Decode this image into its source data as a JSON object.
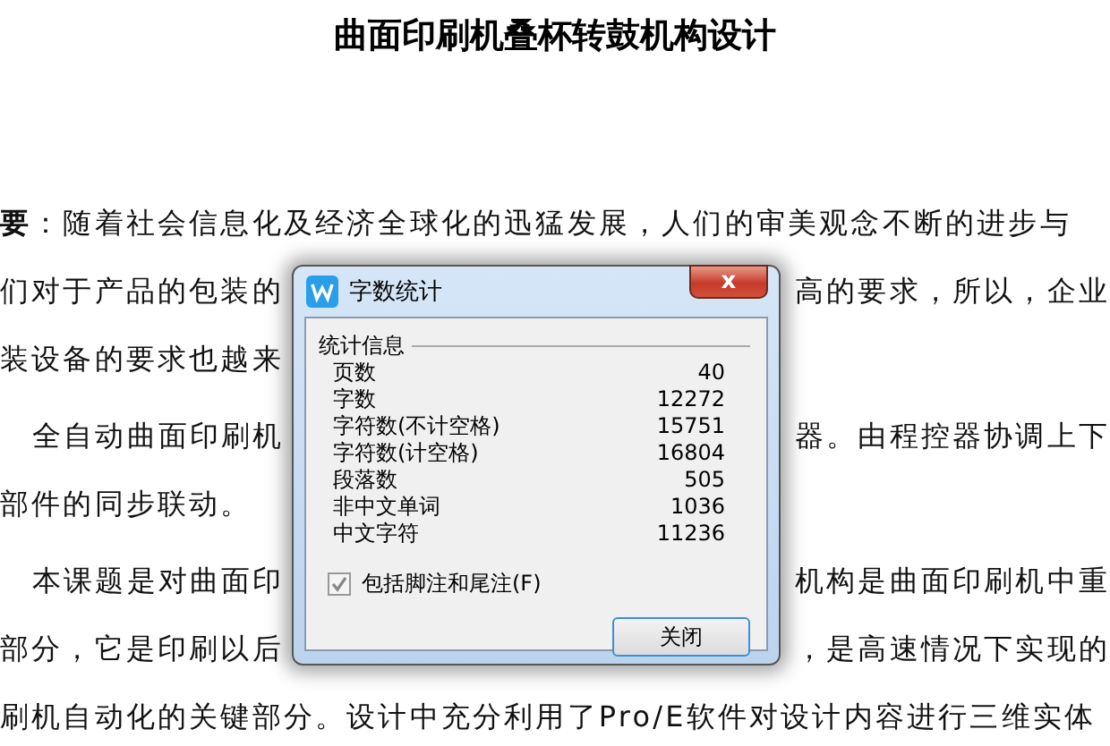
{
  "document": {
    "title": "曲面印刷机叠杯转鼓机构设计",
    "paragraphs": [
      {
        "indent": false,
        "lines": [
          [
            "**要**：随着社会信息化及经济全球化的迅猛发展，人们的审美观念不断的进步与"
          ],
          [
            "们对于产品的包装的",
            "高的要求，所以，企业"
          ],
          [
            "装设备的要求也越来"
          ]
        ]
      },
      {
        "indent": true,
        "lines": [
          [
            "全自动曲面印刷机",
            "器。由程控器协调上下"
          ],
          [
            "部件的同步联动。"
          ]
        ]
      },
      {
        "indent": true,
        "lines": [
          [
            "本课题是对曲面印",
            "机构是曲面印刷机中重"
          ],
          [
            "部分，它是印刷以后",
            "，是高速情况下实现的"
          ],
          [
            "刷机自动化的关键部分。设计中充分利用了Pro/E软件对设计内容进行三维实体"
          ]
        ]
      }
    ]
  },
  "dialog": {
    "title": "字数统计",
    "close_glyph": "x",
    "group": "统计信息",
    "stats": [
      {
        "label": "页数",
        "value": "40"
      },
      {
        "label": "字数",
        "value": "12272"
      },
      {
        "label": "字符数(不计空格)",
        "value": "15751"
      },
      {
        "label": "字符数(计空格)",
        "value": "16804"
      },
      {
        "label": "段落数",
        "value": "505"
      },
      {
        "label": "非中文单词",
        "value": "1036"
      },
      {
        "label": "中文字符",
        "value": "11236"
      }
    ],
    "checkbox": {
      "label": "包括脚注和尾注(F)",
      "checked": true
    },
    "buttons": [
      "关闭"
    ]
  }
}
